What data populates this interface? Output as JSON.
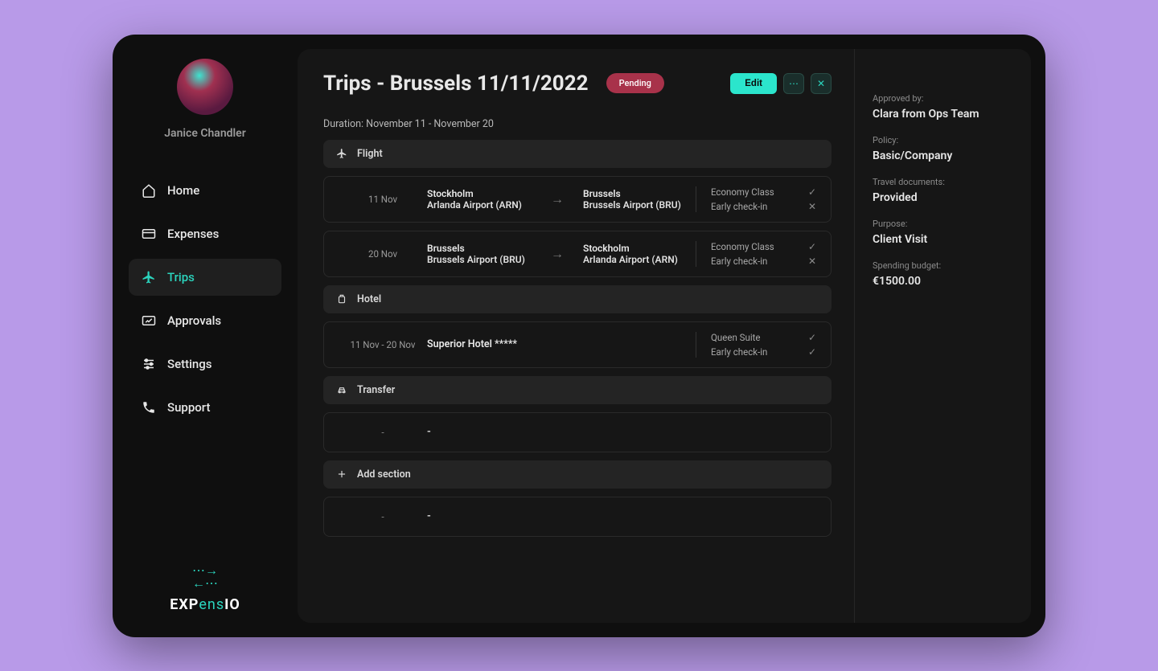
{
  "user": {
    "name": "Janice Chandler"
  },
  "nav": {
    "home": "Home",
    "expenses": "Expenses",
    "trips": "Trips",
    "approvals": "Approvals",
    "settings": "Settings",
    "support": "Support"
  },
  "logo": {
    "part1": "EXP",
    "part2": "ens",
    "part3": "IO"
  },
  "page": {
    "title": "Trips - Brussels 11/11/2022",
    "status": "Pending",
    "duration": "Duration: November 11 - November 20",
    "edit": "Edit"
  },
  "sections": {
    "flight": "Flight",
    "hotel": "Hotel",
    "transfer": "Transfer",
    "add": "Add section"
  },
  "flights": [
    {
      "date": "11 Nov",
      "from_city": "Stockholm",
      "from_airport": "Arlanda Airport (ARN)",
      "to_city": "Brussels",
      "to_airport": "Brussels Airport (BRU)",
      "class": "Economy Class",
      "class_ok": "✓",
      "early": "Early check-in",
      "early_ok": "✕"
    },
    {
      "date": "20 Nov",
      "from_city": "Brussels",
      "from_airport": "Brussels Airport (BRU)",
      "to_city": "Stockholm",
      "to_airport": "Arlanda Airport (ARN)",
      "class": "Economy Class",
      "class_ok": "✓",
      "early": "Early check-in",
      "early_ok": "✕"
    }
  ],
  "hotel": {
    "dates": "11 Nov - 20 Nov",
    "name": "Superior Hotel *****",
    "room": "Queen Suite",
    "room_ok": "✓",
    "early": "Early check-in",
    "early_ok": "✓"
  },
  "meta": {
    "approved_label": "Approved by:",
    "approved_value": "Clara from Ops Team",
    "policy_label": "Policy:",
    "policy_value": "Basic/Company",
    "docs_label": "Travel documents:",
    "docs_value": "Provided",
    "purpose_label": "Purpose:",
    "purpose_value": "Client Visit",
    "budget_label": "Spending budget:",
    "budget_value": "€1500.00"
  },
  "placeholders": {
    "dash": "-"
  }
}
